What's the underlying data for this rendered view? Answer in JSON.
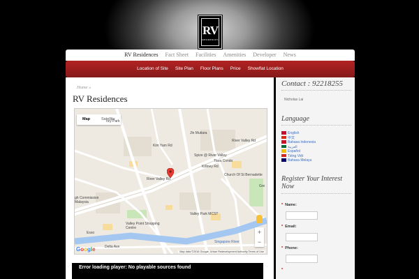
{
  "logo": {
    "main": "RV",
    "sub": "RESIDENCES"
  },
  "topnav": [
    "RV Residences",
    "Fact Sheet",
    "Facilities",
    "Amenities",
    "Developer",
    "News"
  ],
  "subnav": [
    "Location of Site",
    "Site Plan",
    "Floor Plans",
    "Price",
    "Showflat Location"
  ],
  "breadcrumb": {
    "home": "Home",
    "sep": "»"
  },
  "page_title": "RV Residences",
  "map": {
    "tab_map": "Map",
    "tab_satellite": "Satellite",
    "labels": [
      "ncy Park",
      "Jln Mutiara",
      "River Valley Rd",
      "Spize @ River Valley",
      "Tiara Condo",
      "Church Of St Bernadette",
      "Valley Park MCST",
      "Valley Point Shopping Centre",
      "Esso",
      "Singapore River",
      "Delta Ave",
      "River Valley Rd",
      "Kim Yam Rd",
      "Killiney Rd",
      "gh Commission",
      "Malaysia",
      "Gre"
    ],
    "attribution": "Map data ©2016 Google, Urban Redevelopment Authority",
    "terms": "Terms of Use",
    "zoom_in": "+",
    "zoom_out": "−"
  },
  "player_error": "Error loading player: No playable sources found",
  "sidebar": {
    "contact": "Contact : 92218255",
    "agent": "Nicholas Lai",
    "language_title": "Language",
    "languages": [
      {
        "name": "English",
        "flag": "#c8102e"
      },
      {
        "name": "中文",
        "flag": "#de2910"
      },
      {
        "name": "Bahasa Indonesia",
        "flag": "#ce1126"
      },
      {
        "name": "العربية",
        "flag": "#006c35"
      },
      {
        "name": "Español",
        "flag": "#f1bf00"
      },
      {
        "name": "Tiếng Việt",
        "flag": "#da251d"
      },
      {
        "name": "Bahasa Melayu",
        "flag": "#010066"
      }
    ],
    "register_title": "Register Your Interest Now",
    "fields": [
      {
        "label": "Name:"
      },
      {
        "label": "Email:"
      },
      {
        "label": "Phone:"
      }
    ]
  },
  "colors": {
    "nav_red": "#a01f1f",
    "link_blue": "#3a6fc4"
  }
}
